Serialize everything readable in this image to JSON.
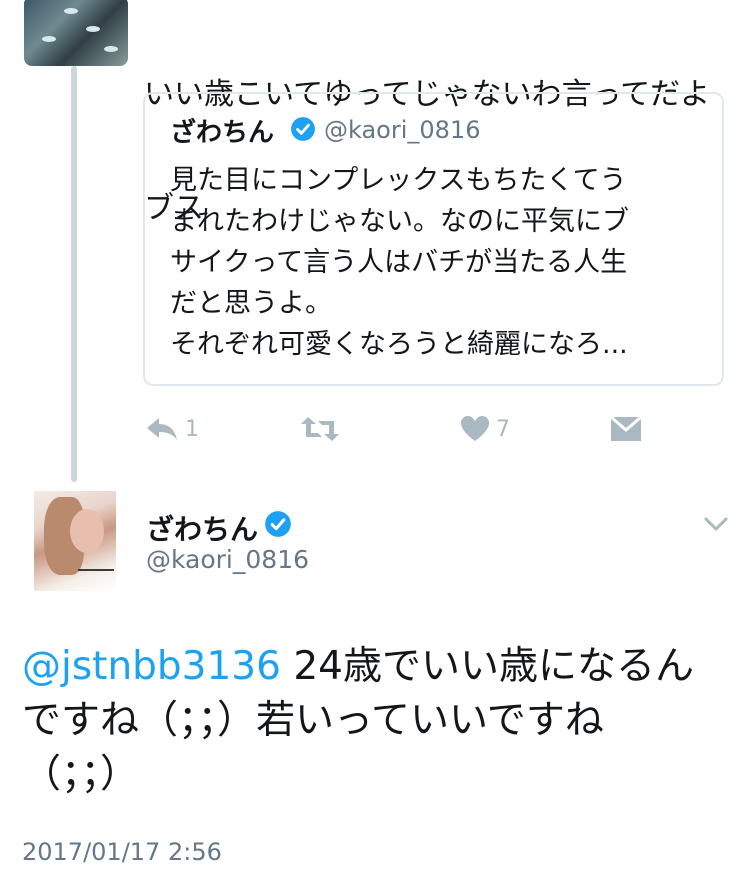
{
  "parent_tweet": {
    "text_lines": [
      "いい歳こいてゆってじゃないわ言ってだよ",
      "ブス"
    ]
  },
  "quoted_tweet": {
    "name": "ざわちん",
    "handle": "@kaori_0816",
    "text_lines": [
      "見た目にコンプレックスもちたくてう",
      "まれたわけじゃない。なのに平気にブ",
      "サイクって言う人はバチが当たる人生",
      "だと思うよ。",
      "それぞれ可愛くなろうと綺麗になろ..."
    ]
  },
  "actions": {
    "reply_count": "1",
    "like_count": "7"
  },
  "main_tweet": {
    "name": "ざわちん",
    "handle": "@kaori_0816",
    "mention": "@jstnbb3136",
    "line1_rest": " 24歳でいい歳になるん",
    "line2": "ですね（；；）若いっていいですね",
    "line3": "（；；）",
    "timestamp": "2017/01/17 2:56"
  },
  "colors": {
    "link_blue": "#1da1f2",
    "verified_blue": "#1da1f2",
    "muted_gray": "#657786",
    "action_gray": "#aab8c2",
    "border": "#e1e8ed"
  },
  "icons": [
    "reply-icon",
    "retweet-icon",
    "heart-icon",
    "envelope-icon",
    "verified-badge-icon",
    "chevron-down-icon"
  ]
}
